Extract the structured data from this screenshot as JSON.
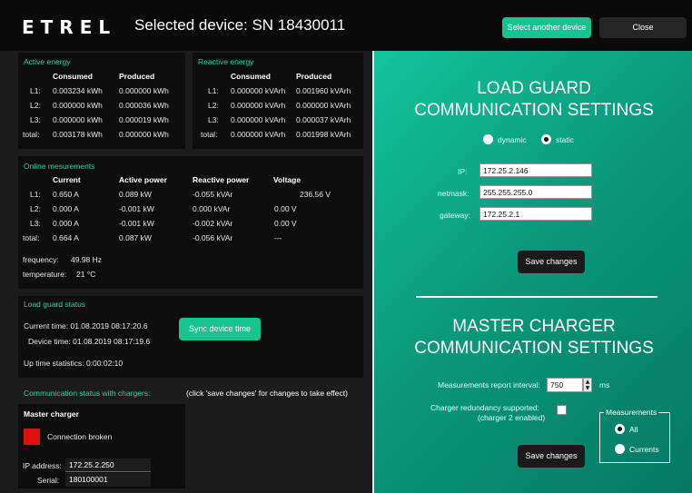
{
  "header": {
    "logo": "ETREL",
    "title": "Selected device:  SN 18430011",
    "select_device_label": "Select another device",
    "close_label": "Close"
  },
  "active_energy": {
    "title": "Active energy",
    "headers": [
      "Consumed",
      "Produced"
    ],
    "rows": [
      {
        "label": "L1:",
        "consumed": "0.003234 kWh",
        "produced": "0.000000 kWh"
      },
      {
        "label": "L2:",
        "consumed": "0.000000 kWh",
        "produced": "0.000036 kWh"
      },
      {
        "label": "L3:",
        "consumed": "0.000000 kWh",
        "produced": "0.000019 kWh"
      },
      {
        "label": "total:",
        "consumed": "0.003178 kWh",
        "produced": "0.000000 kWh"
      }
    ]
  },
  "reactive_energy": {
    "title": "Reactive energy",
    "headers": [
      "Consumed",
      "Produced"
    ],
    "rows": [
      {
        "label": "L1:",
        "consumed": "0.000000 kVArh",
        "produced": "0.001960 kVArh"
      },
      {
        "label": "L2:",
        "consumed": "0.000000 kVArh",
        "produced": "0.000000 kVArh"
      },
      {
        "label": "L3:",
        "consumed": "0.000000 kVArh",
        "produced": "0.000037 kVArh"
      },
      {
        "label": "total:",
        "consumed": "0.000000 kVArh",
        "produced": "0.001998 kVArh"
      }
    ]
  },
  "online": {
    "title": "Online mesurements",
    "headers": [
      "Current",
      "Active power",
      "Reactive power",
      "Voltage"
    ],
    "rows": [
      {
        "label": "L1:",
        "current": "0.650 A",
        "active": "0.089 kW",
        "reactive": "-0.055 kVAr",
        "voltage": "236.56 V"
      },
      {
        "label": "L2:",
        "current": "0.000 A",
        "active": "-0.001 kW",
        "reactive": "0.000 kVAr",
        "voltage": "0.00 V"
      },
      {
        "label": "L3:",
        "current": "0.000 A",
        "active": "-0.001 kW",
        "reactive": "-0.002 kVAr",
        "voltage": "0.00 V"
      },
      {
        "label": "total:",
        "current": "0.664 A",
        "active": "0.087 kW",
        "reactive": "-0.056 kVAr",
        "voltage": "---"
      }
    ],
    "frequency_label": "frequency:",
    "frequency_value": "49.98 Hz",
    "temperature_label": "temperature:",
    "temperature_value": "21 °C"
  },
  "load_guard_status": {
    "title": "Load guard status",
    "current_time": "Current time:  01.08.2019 08:17:20.6",
    "device_time": "Device time:  01.08.2019 08:17:19.6",
    "sync_label": "Sync device time",
    "uptime": "Up time statistics:  0:00:02:10"
  },
  "comm_status": {
    "title": "Communication status with chargers:",
    "hint": "(click 'save changes' for changes to take effect)",
    "master_title": "Master charger",
    "status_color": "#e01010",
    "status_text": "Connection broken",
    "ip_label": "IP address:",
    "ip_value": "172.25.2.250",
    "serial_label": "Serial:",
    "serial_value": "180100001"
  },
  "lg_settings": {
    "title_line1": "LOAD GUARD",
    "title_line2": "COMMUNICATION SETTINGS",
    "mode_dynamic": "dynamic",
    "mode_static": "static",
    "mode_selected": "static",
    "ip_label": "IP:",
    "ip_value": "172.25.2.146",
    "netmask_label": "netmask:",
    "netmask_value": "255.255.255.0",
    "gateway_label": "gateway:",
    "gateway_value": "172.25.2.1",
    "save_label": "Save changes"
  },
  "master_settings": {
    "title_line1": "MASTER CHARGER",
    "title_line2": "COMMUNICATION SETTINGS",
    "interval_label": "Measurements report interval:",
    "interval_value": "750",
    "interval_unit": "ms",
    "redundancy_line1": "Charger redundancy supported:",
    "redundancy_line2": "(charger 2 enabled)",
    "save_label": "Save changes",
    "measurements_title": "Measurements",
    "opt_all": "All",
    "opt_currents": "Currents",
    "opt_selected": "All"
  }
}
